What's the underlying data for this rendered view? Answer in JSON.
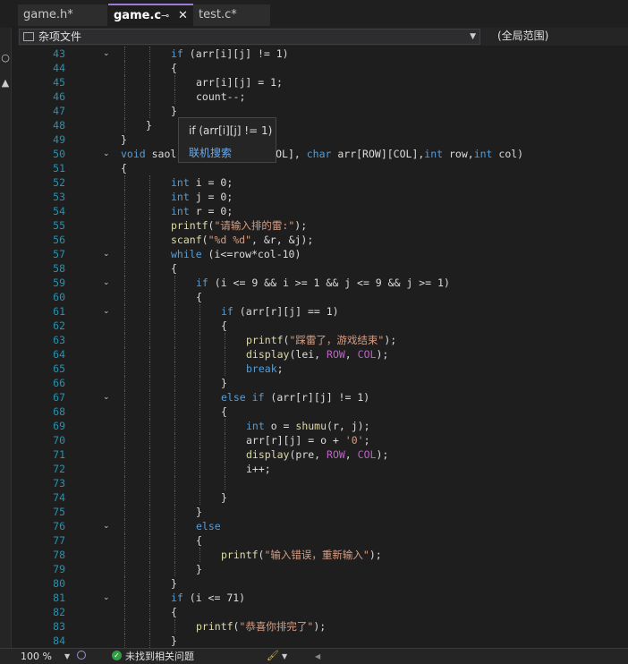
{
  "tabs": [
    {
      "label": "game.h*"
    },
    {
      "label": "game.c"
    },
    {
      "label": "test.c*"
    }
  ],
  "tab_icons": {
    "pin": "pin-icon",
    "close": "close-icon"
  },
  "navbar": {
    "file_scope": "杂项文件",
    "member_scope": "(全局范围)"
  },
  "tooltip": {
    "code": "if (arr[i][j] != 1)",
    "link": "联机搜索"
  },
  "statusbar": {
    "zoom": "100 %",
    "issues": "未找到相关问题"
  },
  "colors": {
    "keyword": "#569cd6",
    "string": "#d69d85",
    "function": "#dcdcaa",
    "macro": "#bd63c5",
    "line_number": "#2b91af",
    "accent": "#9d7ad8"
  },
  "code_lines": [
    {
      "n": "43",
      "fold": true,
      "indent": 2,
      "segs": [
        {
          "t": "if",
          "c": "kw"
        },
        {
          "t": " (arr[i][j] != 1)"
        }
      ]
    },
    {
      "n": "44",
      "indent": 2,
      "segs": [
        {
          "t": "{"
        }
      ]
    },
    {
      "n": "45",
      "indent": 3,
      "segs": [
        {
          "t": "arr[i][j] = 1;"
        }
      ]
    },
    {
      "n": "46",
      "indent": 3,
      "segs": [
        {
          "t": "count--;"
        }
      ]
    },
    {
      "n": "47",
      "indent": 2,
      "segs": [
        {
          "t": "}"
        }
      ]
    },
    {
      "n": "48",
      "indent": 1,
      "segs": [
        {
          "t": "}"
        }
      ]
    },
    {
      "n": "49",
      "indent": 0,
      "segs": [
        {
          "t": "}"
        }
      ]
    },
    {
      "n": "50",
      "fold": true,
      "indent": 0,
      "segs": [
        {
          "t": "void",
          "c": "kw"
        },
        {
          "t": " saol"
        },
        {
          "t": "              [COL], "
        },
        {
          "t": "char",
          "c": "kw"
        },
        {
          "t": " arr[ROW][COL],"
        },
        {
          "t": "int",
          "c": "kw"
        },
        {
          "t": " row,"
        },
        {
          "t": "int",
          "c": "kw"
        },
        {
          "t": " col)"
        }
      ]
    },
    {
      "n": "51",
      "indent": 0,
      "segs": [
        {
          "t": "{"
        }
      ]
    },
    {
      "n": "52",
      "indent": 2,
      "segs": [
        {
          "t": "int",
          "c": "kw"
        },
        {
          "t": " i = 0;"
        }
      ]
    },
    {
      "n": "53",
      "indent": 2,
      "segs": [
        {
          "t": "int",
          "c": "kw"
        },
        {
          "t": " j = 0;"
        }
      ]
    },
    {
      "n": "54",
      "indent": 2,
      "segs": [
        {
          "t": "int",
          "c": "kw"
        },
        {
          "t": " r = 0;"
        }
      ]
    },
    {
      "n": "55",
      "indent": 2,
      "segs": [
        {
          "t": "printf",
          "c": "fn"
        },
        {
          "t": "("
        },
        {
          "t": "\"请输入排的雷:\"",
          "c": "str"
        },
        {
          "t": ");"
        }
      ]
    },
    {
      "n": "56",
      "indent": 2,
      "segs": [
        {
          "t": "scanf",
          "c": "fn"
        },
        {
          "t": "("
        },
        {
          "t": "\"%d %d\"",
          "c": "str"
        },
        {
          "t": ", &r, &j);"
        }
      ]
    },
    {
      "n": "57",
      "fold": true,
      "indent": 2,
      "segs": [
        {
          "t": "while",
          "c": "kw"
        },
        {
          "t": " (i<=row*col-10)"
        }
      ]
    },
    {
      "n": "58",
      "indent": 2,
      "segs": [
        {
          "t": "{"
        }
      ]
    },
    {
      "n": "59",
      "fold": true,
      "indent": 3,
      "segs": [
        {
          "t": "if",
          "c": "kw"
        },
        {
          "t": " (i <= 9 && i >= 1 && j <= 9 && j >= 1)"
        }
      ]
    },
    {
      "n": "60",
      "indent": 3,
      "segs": [
        {
          "t": "{"
        }
      ]
    },
    {
      "n": "61",
      "fold": true,
      "indent": 4,
      "segs": [
        {
          "t": "if",
          "c": "kw"
        },
        {
          "t": " (arr[r][j] == 1)"
        }
      ]
    },
    {
      "n": "62",
      "indent": 4,
      "segs": [
        {
          "t": "{"
        }
      ]
    },
    {
      "n": "63",
      "indent": 5,
      "segs": [
        {
          "t": "printf",
          "c": "fn"
        },
        {
          "t": "("
        },
        {
          "t": "\"踩雷了，游戏结束\"",
          "c": "str"
        },
        {
          "t": ");"
        }
      ]
    },
    {
      "n": "64",
      "indent": 5,
      "segs": [
        {
          "t": "display",
          "c": "fn"
        },
        {
          "t": "(lei, "
        },
        {
          "t": "ROW",
          "c": "mac"
        },
        {
          "t": ", "
        },
        {
          "t": "COL",
          "c": "mac"
        },
        {
          "t": ");"
        }
      ]
    },
    {
      "n": "65",
      "indent": 5,
      "segs": [
        {
          "t": "break",
          "c": "kw"
        },
        {
          "t": ";"
        }
      ]
    },
    {
      "n": "66",
      "indent": 4,
      "segs": [
        {
          "t": "}"
        }
      ]
    },
    {
      "n": "67",
      "fold": true,
      "indent": 4,
      "segs": [
        {
          "t": "else if",
          "c": "kw"
        },
        {
          "t": " (arr[r][j] != 1)"
        }
      ]
    },
    {
      "n": "68",
      "indent": 4,
      "segs": [
        {
          "t": "{"
        }
      ]
    },
    {
      "n": "69",
      "indent": 5,
      "segs": [
        {
          "t": "int",
          "c": "kw"
        },
        {
          "t": " o = "
        },
        {
          "t": "shumu",
          "c": "fn"
        },
        {
          "t": "(r, j);"
        }
      ]
    },
    {
      "n": "70",
      "indent": 5,
      "segs": [
        {
          "t": "arr[r][j] = o + "
        },
        {
          "t": "'0'",
          "c": "str"
        },
        {
          "t": ";"
        }
      ]
    },
    {
      "n": "71",
      "indent": 5,
      "segs": [
        {
          "t": "display",
          "c": "fn"
        },
        {
          "t": "(pre, "
        },
        {
          "t": "ROW",
          "c": "mac"
        },
        {
          "t": ", "
        },
        {
          "t": "COL",
          "c": "mac"
        },
        {
          "t": ");"
        }
      ]
    },
    {
      "n": "72",
      "indent": 5,
      "segs": [
        {
          "t": "i++;"
        }
      ]
    },
    {
      "n": "73",
      "indent": 5,
      "segs": []
    },
    {
      "n": "74",
      "indent": 4,
      "segs": [
        {
          "t": "}"
        }
      ]
    },
    {
      "n": "75",
      "indent": 3,
      "segs": [
        {
          "t": "}"
        }
      ]
    },
    {
      "n": "76",
      "fold": true,
      "indent": 3,
      "segs": [
        {
          "t": "else",
          "c": "kw"
        }
      ]
    },
    {
      "n": "77",
      "indent": 3,
      "segs": [
        {
          "t": "{"
        }
      ]
    },
    {
      "n": "78",
      "indent": 4,
      "segs": [
        {
          "t": "printf",
          "c": "fn"
        },
        {
          "t": "("
        },
        {
          "t": "\"输入错误，重新输入\"",
          "c": "str"
        },
        {
          "t": ");"
        }
      ]
    },
    {
      "n": "79",
      "indent": 3,
      "segs": [
        {
          "t": "}"
        }
      ]
    },
    {
      "n": "80",
      "indent": 2,
      "segs": [
        {
          "t": "}"
        }
      ]
    },
    {
      "n": "81",
      "fold": true,
      "indent": 2,
      "segs": [
        {
          "t": "if",
          "c": "kw"
        },
        {
          "t": " (i <= 71)"
        }
      ]
    },
    {
      "n": "82",
      "indent": 2,
      "segs": [
        {
          "t": "{"
        }
      ]
    },
    {
      "n": "83",
      "indent": 3,
      "segs": [
        {
          "t": "printf",
          "c": "fn"
        },
        {
          "t": "("
        },
        {
          "t": "\"恭喜你排完了\"",
          "c": "str"
        },
        {
          "t": ");"
        }
      ]
    },
    {
      "n": "84",
      "indent": 2,
      "segs": [
        {
          "t": "}"
        }
      ]
    }
  ]
}
